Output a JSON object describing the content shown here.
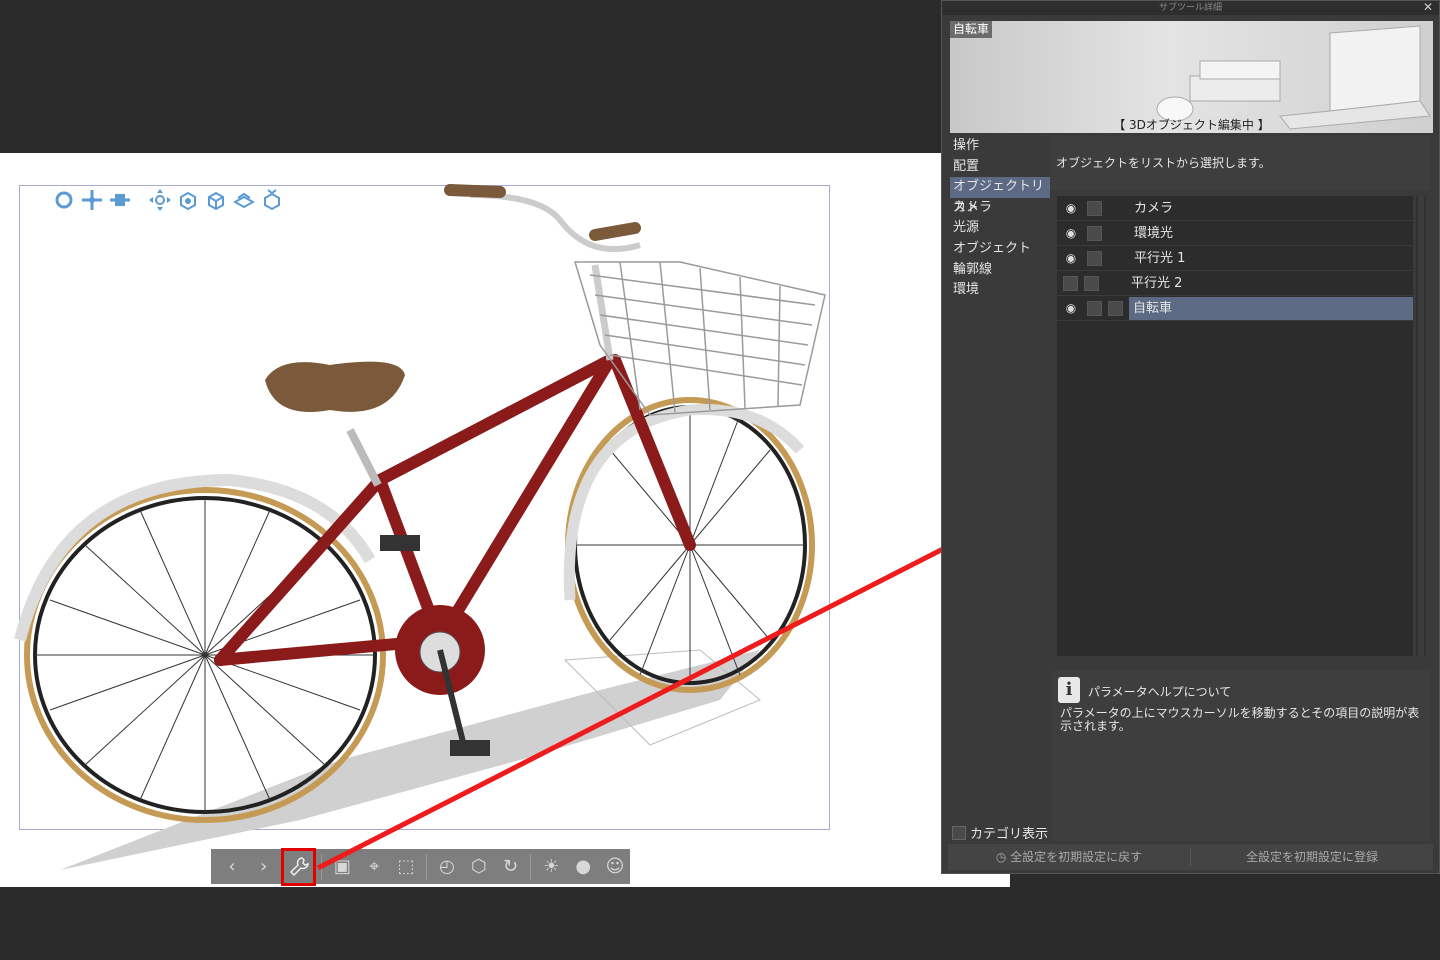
{
  "subtool_panel": {
    "title": "サブツール詳細",
    "preview_tag": "自転車",
    "preview_status": "【 3Dオブジェクト編集中 】",
    "categories": [
      "操作",
      "配置",
      "オブジェクトリスト",
      "カメラ",
      "光源",
      "オブジェクト",
      "輪郭線",
      "環境"
    ],
    "selected_category": "オブジェクトリスト",
    "description": "オブジェクトをリストから選択します。",
    "objects": [
      {
        "label": "カメラ",
        "visible": true
      },
      {
        "label": "環境光",
        "visible": true
      },
      {
        "label": "平行光 1",
        "visible": true
      },
      {
        "label": "平行光 2",
        "visible": false
      },
      {
        "label": "自転車",
        "visible": true,
        "selected": true
      }
    ],
    "help_title": "パラメータヘルプについて",
    "help_body": "パラメータの上にマウスカーソルを移動するとその項目の説明が表示されます。",
    "category_display_label": "カテゴリ表示",
    "reset_label": "全設定を初期設定に戻す",
    "register_label": "全設定を初期設定に登録"
  },
  "bottom_toolbar": {
    "icons": [
      "prev-icon",
      "next-icon",
      "wrench-icon",
      "camera-icon",
      "fit-icon",
      "floor-icon",
      "dial-icon",
      "object-icon",
      "rotate-icon",
      "light-icon",
      "lightbulb-icon",
      "person-icon"
    ],
    "highlighted": "wrench-icon"
  },
  "colors": {
    "accent_select": "#5c6a84",
    "highlight_red": "#e00000",
    "viewport_frame": "#a9a9d8",
    "tool_icon_blue": "#5b9bd5",
    "bike_frame": "#8b1a1a"
  }
}
